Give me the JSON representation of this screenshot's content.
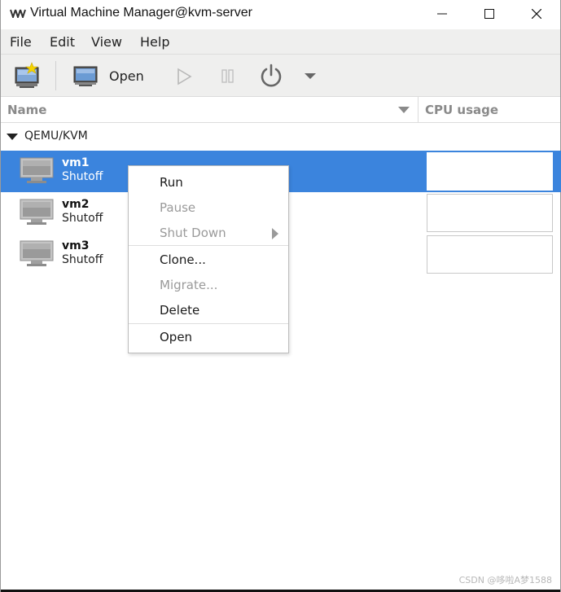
{
  "window": {
    "title": "Virtual Machine Manager@kvm-server"
  },
  "menubar": {
    "items": [
      "File",
      "Edit",
      "View",
      "Help"
    ]
  },
  "toolbar": {
    "open_label": "Open"
  },
  "columns": {
    "name": "Name",
    "cpu": "CPU usage"
  },
  "group": {
    "label": "QEMU/KVM"
  },
  "vms": [
    {
      "name": "vm1",
      "status": "Shutoff",
      "selected": true
    },
    {
      "name": "vm2",
      "status": "Shutoff",
      "selected": false
    },
    {
      "name": "vm3",
      "status": "Shutoff",
      "selected": false
    }
  ],
  "context_menu": {
    "run": "Run",
    "pause": "Pause",
    "shut_down": "Shut Down",
    "clone": "Clone...",
    "migrate": "Migrate...",
    "delete": "Delete",
    "open": "Open"
  },
  "watermark": "CSDN @哆啦A梦1588",
  "colors": {
    "selection": "#3b84dd",
    "menubar_bg": "#efefee",
    "disabled_text": "#9a9a9a"
  }
}
